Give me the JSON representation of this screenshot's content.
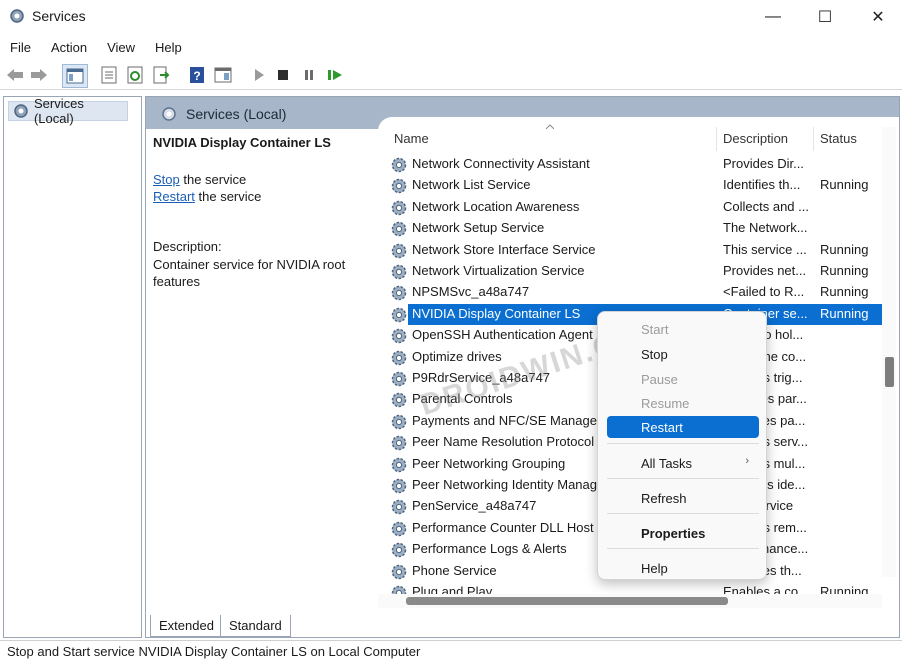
{
  "window": {
    "title": "Services",
    "minimize": "—",
    "maximize": "☐",
    "close": "✕"
  },
  "menubar": {
    "items": [
      "File",
      "Action",
      "View",
      "Help"
    ]
  },
  "toolbar": {
    "icons": [
      "back-arrow-icon",
      "forward-arrow-icon",
      "show-hide-console-tree-icon",
      "properties-icon",
      "refresh-icon",
      "export-list-icon",
      "help-icon",
      "show-hide-action-pane-icon",
      "start-service-icon",
      "stop-service-icon",
      "pause-service-icon",
      "restart-service-icon"
    ]
  },
  "tree": {
    "root_label": "Services (Local)"
  },
  "pane": {
    "header": "Services (Local)"
  },
  "details": {
    "service_name": "NVIDIA Display Container LS",
    "stop_link": "Stop",
    "stop_suffix": " the service",
    "restart_link": "Restart",
    "restart_suffix": " the service",
    "description_label": "Description:",
    "description_text": "Container service for NVIDIA root features"
  },
  "columns": {
    "name": "Name",
    "description": "Description",
    "status": "Status"
  },
  "rows": [
    {
      "name": "Network Connectivity Assistant",
      "description": "Provides Dir...",
      "status": ""
    },
    {
      "name": "Network List Service",
      "description": "Identifies th...",
      "status": "Running"
    },
    {
      "name": "Network Location Awareness",
      "description": "Collects and ...",
      "status": ""
    },
    {
      "name": "Network Setup Service",
      "description": "The Network...",
      "status": ""
    },
    {
      "name": "Network Store Interface Service",
      "description": "This service ...",
      "status": "Running"
    },
    {
      "name": "Network Virtualization Service",
      "description": "Provides net...",
      "status": "Running"
    },
    {
      "name": "NPSMSvc_a48a747",
      "description": "<Failed to R...",
      "status": "Running"
    },
    {
      "name": "NVIDIA Display Container LS",
      "description": "Container se...",
      "status": "Running",
      "selected": true
    },
    {
      "name": "OpenSSH Authentication Agent",
      "description": "Agent to hol...",
      "status": ""
    },
    {
      "name": "Optimize drives",
      "description": "Helps the co...",
      "status": ""
    },
    {
      "name": "P9RdrService_a48a747",
      "description": "Enables trig...",
      "status": ""
    },
    {
      "name": "Parental Controls",
      "description": "Enforces par...",
      "status": ""
    },
    {
      "name": "Payments and NFC/SE Manager",
      "description": "Manages pa...",
      "status": ""
    },
    {
      "name": "Peer Name Resolution Protocol",
      "description": "Enables serv...",
      "status": ""
    },
    {
      "name": "Peer Networking Grouping",
      "description": "Enables mul...",
      "status": ""
    },
    {
      "name": "Peer Networking Identity Manager",
      "description": "Provides ide...",
      "status": ""
    },
    {
      "name": "PenService_a48a747",
      "description": "Pen Service",
      "status": ""
    },
    {
      "name": "Performance Counter DLL Host",
      "description": "Enables rem...",
      "status": ""
    },
    {
      "name": "Performance Logs & Alerts",
      "description": "Performance...",
      "status": ""
    },
    {
      "name": "Phone Service",
      "description": "Manages th...",
      "status": ""
    },
    {
      "name": "Plug and Play",
      "description": "Enables a co...",
      "status": "Running"
    }
  ],
  "tabs": {
    "extended": "Extended",
    "standard": "Standard"
  },
  "context_menu": {
    "start": "Start",
    "stop": "Stop",
    "pause": "Pause",
    "resume": "Resume",
    "restart": "Restart",
    "all_tasks": "All Tasks",
    "all_tasks_arrow": "›",
    "refresh": "Refresh",
    "properties": "Properties",
    "help": "Help"
  },
  "status_bar": {
    "text": "Stop and Start service NVIDIA Display Container LS on Local Computer"
  },
  "watermark": "DROIDWIN.COM",
  "colors": {
    "selection": "#0a6fd1",
    "header": "#a7b6c8",
    "link": "#1a5fb4"
  }
}
